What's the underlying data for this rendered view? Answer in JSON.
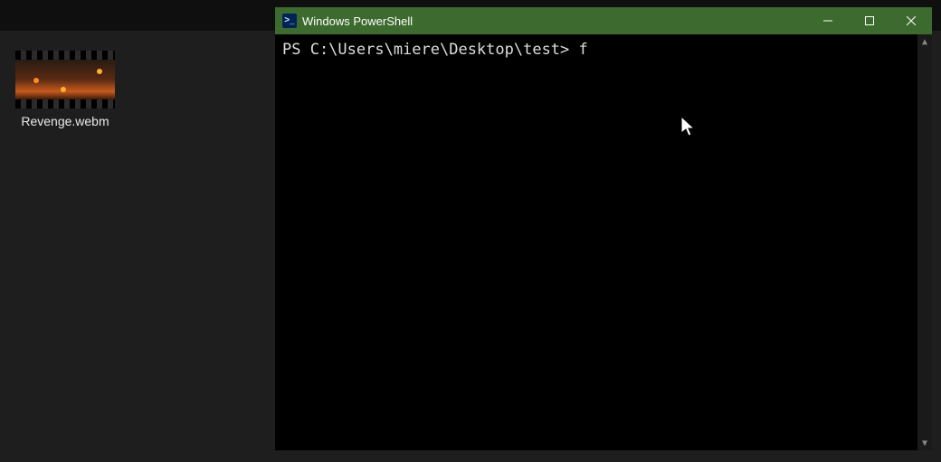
{
  "desktop": {
    "file": {
      "name": "Revenge.webm"
    }
  },
  "powershell": {
    "title": "Windows PowerShell",
    "icon_glyph": ">_",
    "prompt": "PS C:\\Users\\miere\\Desktop\\test> ",
    "command": "f",
    "controls": {
      "minimize": "minimize",
      "maximize": "maximize",
      "close": "close"
    }
  }
}
